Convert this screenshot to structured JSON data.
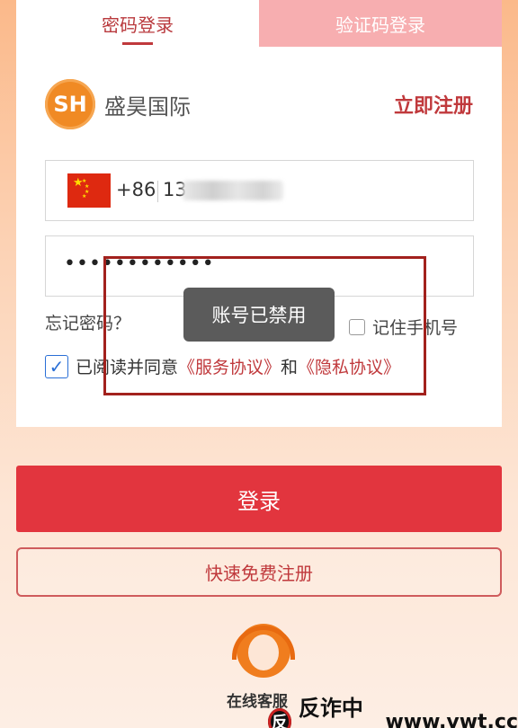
{
  "tabs": [
    {
      "label": "密码登录",
      "active": true
    },
    {
      "label": "验证码登录",
      "active": false
    }
  ],
  "brand": {
    "logo_text": "SH",
    "name": "盛昊国际"
  },
  "register_link": "立即注册",
  "phone": {
    "country_code": "+86",
    "value": "13"
  },
  "password": {
    "masked_value": "••••••••••••"
  },
  "forgot_password": "忘记密码？",
  "remember_phone": {
    "label": "记住手机号",
    "checked": false
  },
  "agreement": {
    "checked": true,
    "prefix": "已阅读并同意",
    "service_link": "《服务协议》",
    "and": "和",
    "privacy_link": "《隐私协议》"
  },
  "toast": "账号已禁用",
  "login_button": "登录",
  "quick_register_button": "快速免费注册",
  "support_label": "在线客服",
  "watermark": {
    "text": "反诈中心",
    "url": "www.vwt.cc"
  },
  "colors": {
    "accent": "#c0393c",
    "button": "#e2353e",
    "tab_inactive": "#f7aeb0",
    "checkbox": "#2a6fd6"
  }
}
